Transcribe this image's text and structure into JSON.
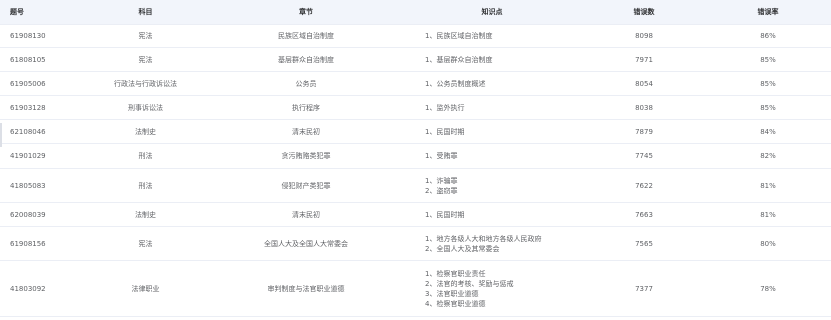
{
  "table": {
    "headers": {
      "id": "题号",
      "subject": "科目",
      "chapter": "章节",
      "points": "知识点",
      "errors": "错误数",
      "rate": "错误率"
    },
    "rows": [
      {
        "id": "61908130",
        "subject": "宪法",
        "chapter": "民族区域自治制度",
        "points": [
          "1、民族区域自治制度"
        ],
        "errors": "8098",
        "rate": "86%"
      },
      {
        "id": "61808105",
        "subject": "宪法",
        "chapter": "基层群众自治制度",
        "points": [
          "1、基层群众自治制度"
        ],
        "errors": "7971",
        "rate": "85%"
      },
      {
        "id": "61905006",
        "subject": "行政法与行政诉讼法",
        "chapter": "公务员",
        "points": [
          "1、公务员制度概述"
        ],
        "errors": "8054",
        "rate": "85%"
      },
      {
        "id": "61903128",
        "subject": "刑事诉讼法",
        "chapter": "执行程序",
        "points": [
          "1、监外执行"
        ],
        "errors": "8038",
        "rate": "85%"
      },
      {
        "id": "62108046",
        "subject": "法制史",
        "chapter": "清末民初",
        "points": [
          "1、民国时期"
        ],
        "errors": "7879",
        "rate": "84%"
      },
      {
        "id": "41901029",
        "subject": "刑法",
        "chapter": "贪污贿赂类犯罪",
        "points": [
          "1、受贿罪"
        ],
        "errors": "7745",
        "rate": "82%"
      },
      {
        "id": "41805083",
        "subject": "刑法",
        "chapter": "侵犯财产类犯罪",
        "points": [
          "1、诈骗罪",
          "2、盗窃罪"
        ],
        "errors": "7622",
        "rate": "81%"
      },
      {
        "id": "62008039",
        "subject": "法制史",
        "chapter": "清末民初",
        "points": [
          "1、民国时期"
        ],
        "errors": "7663",
        "rate": "81%"
      },
      {
        "id": "61908156",
        "subject": "宪法",
        "chapter": "全国人大及全国人大常委会",
        "points": [
          "1、地方各级人大和地方各级人民政府",
          "2、全国人大及其常委会"
        ],
        "errors": "7565",
        "rate": "80%"
      },
      {
        "id": "41803092",
        "subject": "法律职业",
        "chapter": "审判制度与法官职业道德",
        "points": [
          "1、检察官职业责任",
          "2、法官的考核、奖励与惩戒",
          "3、法官职业道德",
          "4、检察官职业道德"
        ],
        "errors": "7377",
        "rate": "78%"
      }
    ]
  }
}
